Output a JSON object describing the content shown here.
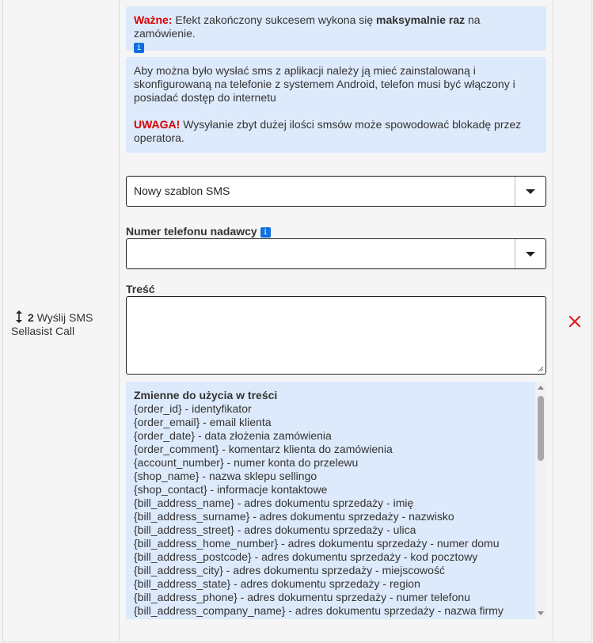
{
  "step": {
    "number": "2",
    "label": "Wyślij SMS Sellasist Call"
  },
  "notice1": {
    "important": "Ważne:",
    "text_before": " Efekt zakończony sukcesem wykona się ",
    "bold": "maksymalnie raz",
    "text_after": " na zamówienie.",
    "info_glyph": "i"
  },
  "notice2": {
    "text": "Aby można było wysłać sms z aplikacji należy ją mieć zainstalowaną i skonfigurowaną na telefonie z systemem Android, telefon musi być włączony i posiadać dostęp do internetu",
    "warning": "UWAGA!",
    "warning_text": " Wysyłanie zbyt dużej ilości smsów może spowodować blokadę przez operatora."
  },
  "template_select": {
    "value": "Nowy szablon SMS"
  },
  "sender_phone": {
    "label": "Numer telefonu nadawcy",
    "info_glyph": "i",
    "value": ""
  },
  "content": {
    "label": "Treść",
    "value": ""
  },
  "variables": {
    "title": "Zmienne do użycia w treści",
    "items": [
      "{order_id} - identyfikator",
      "{order_email} - email klienta",
      "{order_date} - data złożenia zamówienia",
      "{order_comment} - komentarz klienta do zamówienia",
      "{account_number} - numer konta do przelewu",
      "{shop_name} - nazwa sklepu sellingo",
      "{shop_contact} - informacje kontaktowe",
      "{bill_address_name} - adres dokumentu sprzedaży - imię",
      "{bill_address_surname} - adres dokumentu sprzedaży - nazwisko",
      "{bill_address_street} - adres dokumentu sprzedaży - ulica",
      "{bill_address_home_number} - adres dokumentu sprzedaży - numer domu",
      "{bill_address_postcode} - adres dokumentu sprzedaży - kod pocztowy",
      "{bill_address_city} - adres dokumentu sprzedaży - miejscowość",
      "{bill_address_state} - adres dokumentu sprzedaży - region",
      "{bill_address_phone} - adres dokumentu sprzedaży - numer telefonu",
      "{bill_address_company_name} - adres dokumentu sprzedaży - nazwa firmy"
    ]
  },
  "colors": {
    "info_bg": "#ddeafb",
    "warning_red": "#d90000",
    "info_icon": "#0d6fe0",
    "delete_red": "#e02020"
  },
  "icons": {
    "drag": "updown-arrow-icon",
    "delete": "close-icon",
    "dropdown": "caret-down-icon"
  }
}
